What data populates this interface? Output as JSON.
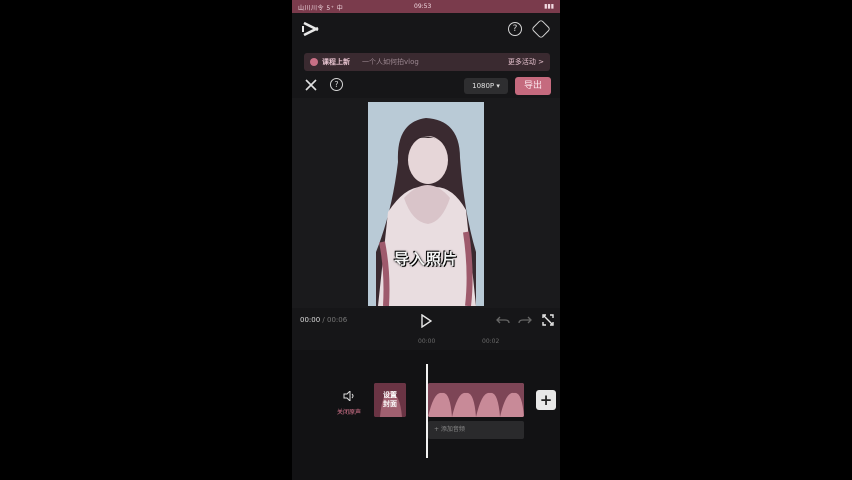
{
  "status_bar": {
    "left": "山川川令 5⁺ 中",
    "center": "09:53",
    "right": "▮▮▮"
  },
  "banner": {
    "label": "课程上新",
    "text": "一个人如何拍vlog",
    "more": "更多活动 >"
  },
  "editor": {
    "resolution": "1080P ▾",
    "export_label": "导出"
  },
  "preview": {
    "caption": "导入照片"
  },
  "playback": {
    "current": "00:00",
    "separator": " / ",
    "duration": "00:06"
  },
  "ruler": {
    "marks": [
      "00:00",
      "00:02"
    ]
  },
  "timeline": {
    "mute_label": "关闭原声",
    "cover_label": "设置\n封面",
    "audio_label": "+ 添加音频",
    "add_label": "+"
  },
  "colors": {
    "accent": "#c56a7e",
    "status_bar": "#7a3b4c",
    "background": "#161618"
  }
}
